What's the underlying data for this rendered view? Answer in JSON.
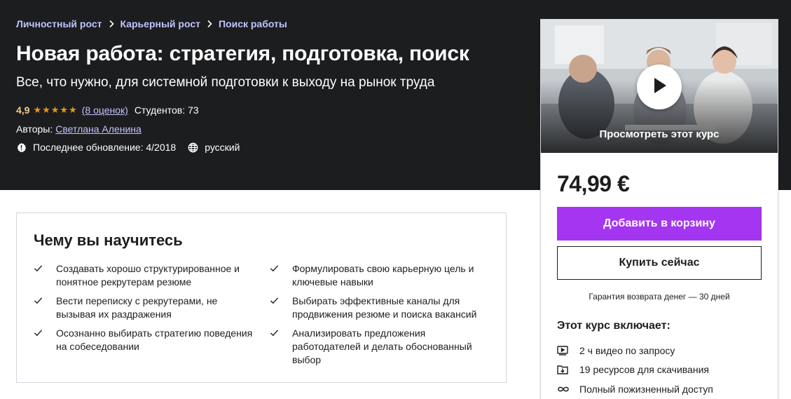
{
  "breadcrumb": {
    "items": [
      "Личностный рост",
      "Карьерный рост",
      "Поиск работы"
    ]
  },
  "course": {
    "title": "Новая работа: стратегия, подготовка, поиск",
    "subtitle": "Все, что нужно, для системной подготовки к выходу на рынок труда",
    "rating": "4,9",
    "rating_value": 4.9,
    "stars": "★★★★★",
    "reviews": "(8 оценок)",
    "students": "Студентов: 73",
    "authors_label": "Авторы:",
    "author": "Светлана Аленина",
    "updated": "Последнее обновление: 4/2018",
    "language": "русский"
  },
  "learn": {
    "title": "Чему вы научитесь",
    "items": [
      "Создавать хорошо структурированное и понятное рекрутерам резюме",
      "Формулировать свою карьерную цель и ключевые навыки",
      "Вести переписку с рекрутерами, не вызывая их раздражения",
      "Выбирать эффективные каналы для продвижения резюме и поиска вакансий",
      "Осознанно выбирать стратегию поведения на собеседовании",
      "Анализировать предложения работодателей и делать обоснованный выбор"
    ]
  },
  "sidebar": {
    "preview_label": "Просмотреть этот курс",
    "price": "74,99 €",
    "add_to_cart": "Добавить в корзину",
    "buy_now": "Купить сейчас",
    "guarantee": "Гарантия возврата денег — 30 дней",
    "includes_title": "Этот курс включает:",
    "includes": [
      {
        "icon": "video-icon",
        "text": "2 ч видео по запросу"
      },
      {
        "icon": "download-folder-icon",
        "text": "19 ресурсов для скачивания"
      },
      {
        "icon": "infinity-icon",
        "text": "Полный пожизненный доступ"
      }
    ]
  },
  "colors": {
    "hero_bg": "#1c1d1f",
    "link": "#c0c4fc",
    "rating": "#f3ca8c",
    "star": "#e59819",
    "cta": "#a435f0"
  }
}
